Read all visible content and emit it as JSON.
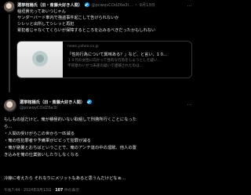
{
  "post1": {
    "display_name": "選挙棺桶氏（旧・斎藤大好き人間）",
    "handle": "@pcwqvCOdZ6e3I...",
    "date": "・ 9月13日",
    "more": "…",
    "lines": [
      "稲垣貴元ってあいつじゃん",
      "サンダーバード車内で強盗事件起こして告げられないか",
      "シレッと出所してシレッと再犯",
      "累犯者じゃなくてくらいが保障するところを込みるべきだったかもしれない"
    ],
    "card": {
      "domain": "news.yahoo.co.jp",
      "title": "「性的行為について興味ある？」など、と言い、1 0...",
      "desc_1": "１０代の女性に向かって性的な行為をしようとした疑い...",
      "desc_2": "不同意わいせつ未遂の疑いで逮捕されたのは..."
    }
  },
  "post2": {
    "display_name": "選挙棺桶氏（旧・斎藤大好き人間）",
    "handle": "@pcwqvCOdZ6e3I",
    "more": "…",
    "lines": [
      "もしもの話だけど、俺が積極的いない取組して刑務所行くことになった",
      "ら…",
      "・人間の受けがらこの世から一匹減る",
      "・俺の性犯罪者や予備軍がビビって犯罪が減る",
      "・俺が避暑とおちばということで、俺のアンチ達の中の溜飲、他人の置",
      "き込みを俺の仕業扱いしたりしなくなる",
      "",
      "冷静に考えたら それなりにメリットもあると思うんだけどなぁ…"
    ],
    "time": "午後7:44",
    "date": "2024年9月13日",
    "views_count": "107",
    "views_label": "件の表示"
  }
}
